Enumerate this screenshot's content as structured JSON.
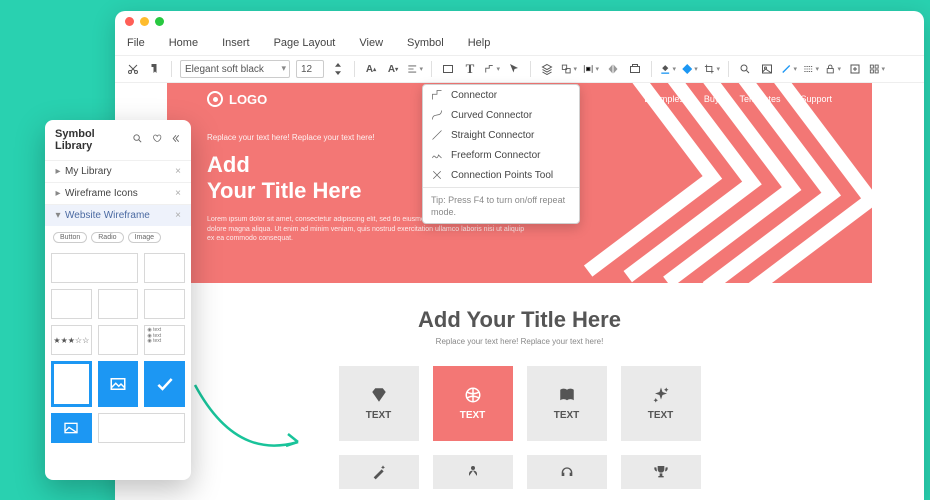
{
  "menubar": {
    "items": [
      "File",
      "Home",
      "Insert",
      "Page Layout",
      "View",
      "Symbol",
      "Help"
    ]
  },
  "toolbar": {
    "font": "Elegant soft black",
    "size": "12"
  },
  "dropdown": {
    "items": [
      {
        "icon": "connector",
        "label": "Connector"
      },
      {
        "icon": "curved",
        "label": "Curved Connector"
      },
      {
        "icon": "straight",
        "label": "Straight Connector"
      },
      {
        "icon": "freeform",
        "label": "Freeform Connector"
      },
      {
        "icon": "points",
        "label": "Connection Points Tool"
      }
    ],
    "tip": "Tip: Press F4 to turn on/off repeat mode."
  },
  "panel": {
    "title": "Symbol Library",
    "libs": [
      {
        "name": "My Library",
        "sel": false,
        "bullet": "▸"
      },
      {
        "name": "Wireframe Icons",
        "sel": false,
        "bullet": "▸"
      },
      {
        "name": "Website Wireframe",
        "sel": true,
        "bullet": "▾"
      }
    ],
    "chips": [
      "Button",
      "Radio",
      "Image"
    ]
  },
  "hero": {
    "logo": "LOGO",
    "nav": [
      "Examples",
      "Buy",
      "Templates",
      "Support"
    ],
    "sub": "Replace your text here!    Replace your text here!",
    "title_1": "Add",
    "title_2": "Your Title Here",
    "lorem": "Lorem ipsum dolor sit amet, consectetur adipiscing elit, sed do eiusmod tempor incididunt ut labore et dolore magna aliqua. Ut enim ad minim veniam, quis nostrud exercitation ullamco laboris nisi ut aliquip ex ea commodo consequat."
  },
  "section": {
    "title": "Add Your Title Here",
    "sub": "Replace your text here!    Replace your text here!",
    "cards": [
      {
        "icon": "diamond",
        "label": "TEXT",
        "active": false
      },
      {
        "icon": "ball",
        "label": "TEXT",
        "active": true
      },
      {
        "icon": "book",
        "label": "TEXT",
        "active": false
      },
      {
        "icon": "spark",
        "label": "TEXT",
        "active": false
      }
    ],
    "row2_icons": [
      "wand",
      "person",
      "headset",
      "trophy"
    ]
  }
}
